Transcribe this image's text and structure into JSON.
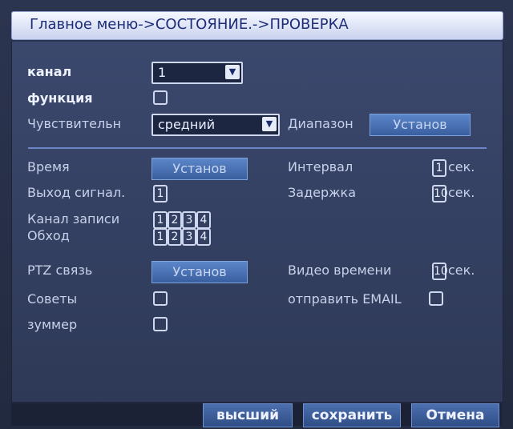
{
  "breadcrumb": "Главное меню->СОСТОЯНИЕ.->ПРОВЕРКА",
  "fields": {
    "channel_label": "канал",
    "channel_value": "1",
    "function_label": "функция",
    "sensitivity_label": "Чувствительн",
    "sensitivity_value": "средний",
    "range_label": "Диапазон",
    "range_button": "Установ",
    "time_label": "Время",
    "time_button": "Установ",
    "interval_label": "Интервал",
    "interval_value": "1",
    "interval_unit": "сек.",
    "output_label": "Выход сигнал.",
    "output_value": "1",
    "delay_label": "Задержка",
    "delay_value": "10",
    "delay_unit": "сек.",
    "record_label": "Канал записи",
    "record_channels": [
      "1",
      "2",
      "3",
      "4"
    ],
    "bypass_label": "Обход",
    "bypass_channels": [
      "1",
      "2",
      "3",
      "4"
    ],
    "ptz_label": "PTZ связь",
    "ptz_button": "Установ",
    "video_time_label": "Видео времени",
    "video_time_value": "10",
    "video_time_unit": "сек.",
    "tips_label": "Советы",
    "email_label": "отправить EMAIL",
    "buzzer_label": "зуммер"
  },
  "footer": {
    "advanced": "высший",
    "save": "сохранить",
    "cancel": "Отмена"
  }
}
